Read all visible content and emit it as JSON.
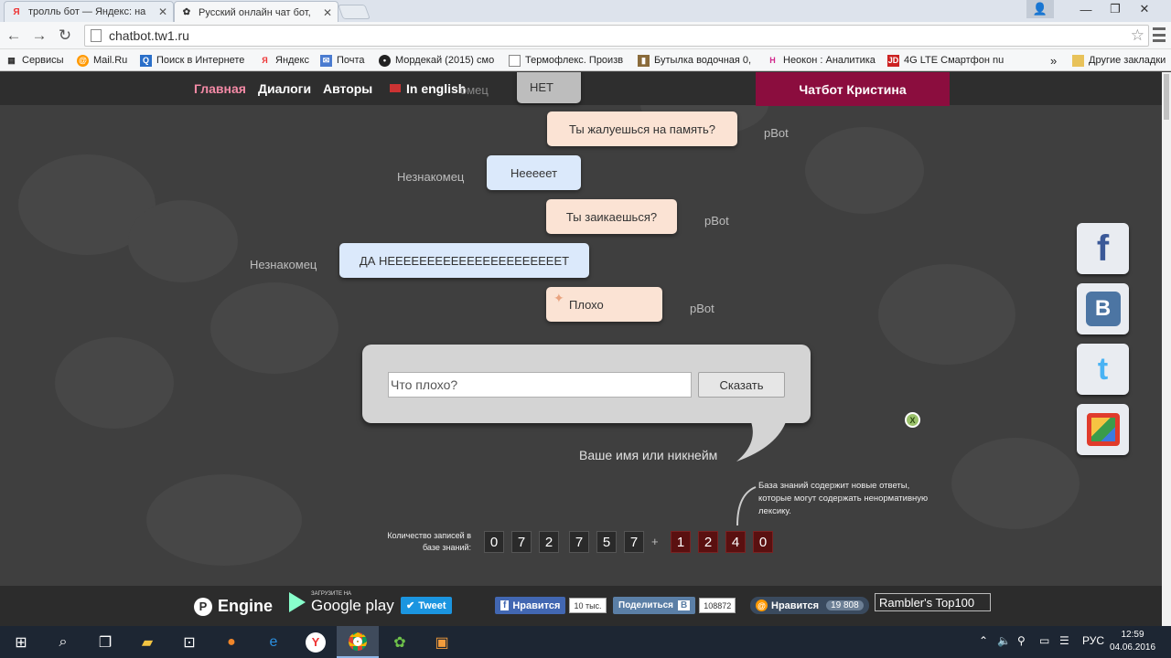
{
  "browser": {
    "tabs": [
      {
        "title": "тролль бот — Яндекс: на",
        "icon": "yandex-icon"
      },
      {
        "title": "Русский онлайн чат бот,",
        "icon": "chatbot-icon"
      }
    ],
    "address": "chatbot.tw1.ru",
    "bookmarks": [
      {
        "label": "Сервисы",
        "icon": "apps-icon"
      },
      {
        "label": "Mail.Ru",
        "icon": "mailru-icon"
      },
      {
        "label": "Поиск в Интернете",
        "icon": "search-icon"
      },
      {
        "label": "Яндекс",
        "icon": "yandex-icon"
      },
      {
        "label": "Почта",
        "icon": "mail-icon"
      },
      {
        "label": "Мордекай (2015) смо",
        "icon": "avatar-icon"
      },
      {
        "label": "Термофлекс. Произв",
        "icon": "page-icon"
      },
      {
        "label": "Бутылка водочная 0,",
        "icon": "bottle-icon"
      },
      {
        "label": "Неокон : Аналитика",
        "icon": "neokon-icon"
      },
      {
        "label": "4G LTE Смартфон nu",
        "icon": "jd-icon"
      }
    ],
    "bookmarks_overflow": "»",
    "other_bookmarks": "Другие закладки"
  },
  "site": {
    "nav": [
      "Главная",
      "Диалоги",
      "Авторы"
    ],
    "english": "In english",
    "kristina": "Чатбот Кристина",
    "partial_label": "омец",
    "messages": [
      {
        "side": "bot",
        "text": "НЕТ",
        "who": ""
      },
      {
        "side": "bot",
        "text": "Ты жалуешься на память?",
        "who": "pBot"
      },
      {
        "side": "user",
        "text": "Нееееет",
        "who": "Незнакомец"
      },
      {
        "side": "bot",
        "text": "Ты заикаешься?",
        "who": "pBot"
      },
      {
        "side": "user",
        "text": "ДА НЕЕЕЕЕЕЕЕЕЕЕЕЕЕЕЕЕЕЕЕЕЕТ",
        "who": "Незнакомец"
      },
      {
        "side": "bot",
        "text": "Плохо",
        "who": "pBot"
      }
    ],
    "input_value": "Что плохо?",
    "say_button": "Сказать",
    "nickname_label": "Ваше имя или никнейм",
    "social": [
      "facebook-icon",
      "vk-icon",
      "twitter-icon",
      "bookmark-icon"
    ],
    "kb_note": "База знаний содержит новые ответы, которые могут содержать ненормативную лексику.",
    "kb_label": "Количество записей в базе знаний:",
    "kb_digits": [
      "0",
      "7",
      "2",
      "7",
      "5",
      "7"
    ],
    "kb_plus": "+",
    "kb_new_digits": [
      "1",
      "2",
      "4",
      "0"
    ],
    "footer": {
      "engine": "Engine",
      "gplay_pre": "ЗАГРУЗИТЕ НА",
      "gplay": "Google play",
      "tweet": "Tweet",
      "fb_like": "Нравится",
      "fb_count": "10 тыс.",
      "vk_share": "Поделиться",
      "vk_count": "108872",
      "ok_like": "Нравится",
      "ok_count": "19 808",
      "rambler": "Rambler's Top100"
    }
  },
  "taskbar": {
    "lang": "РУС",
    "time": "12:59",
    "date": "04.06.2016"
  }
}
